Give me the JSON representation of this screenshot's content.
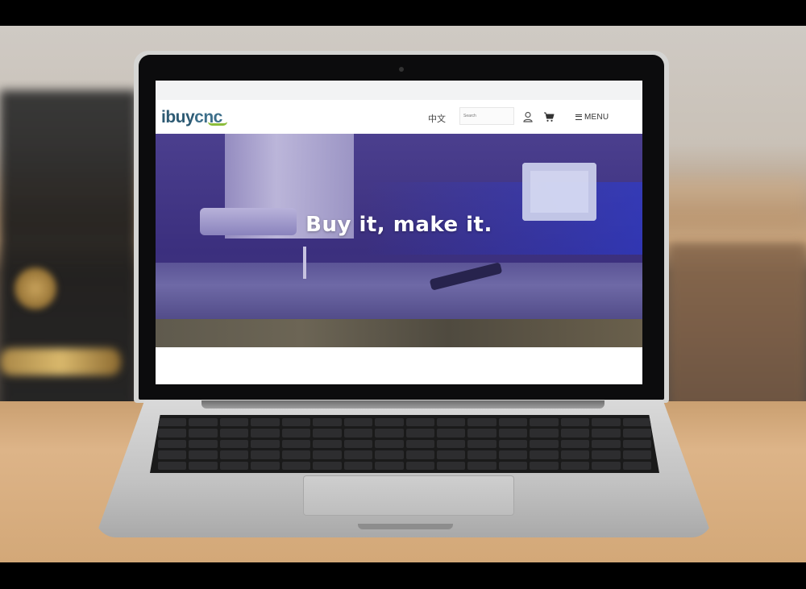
{
  "site": {
    "logo_text": "ibuycnc",
    "logo_prefix": "ibuy",
    "logo_suffix": "cnc",
    "colors": {
      "brand_blue": "#2d5a73",
      "brand_green": "#8bbd3a",
      "hero_overlay": "#3b2f7e"
    }
  },
  "nav": {
    "language_label": "中文",
    "search_placeholder": "Search",
    "account_icon": "user-icon",
    "cart_icon": "cart-icon",
    "menu_label": "MENU"
  },
  "hero": {
    "headline": "Buy it, make it."
  }
}
